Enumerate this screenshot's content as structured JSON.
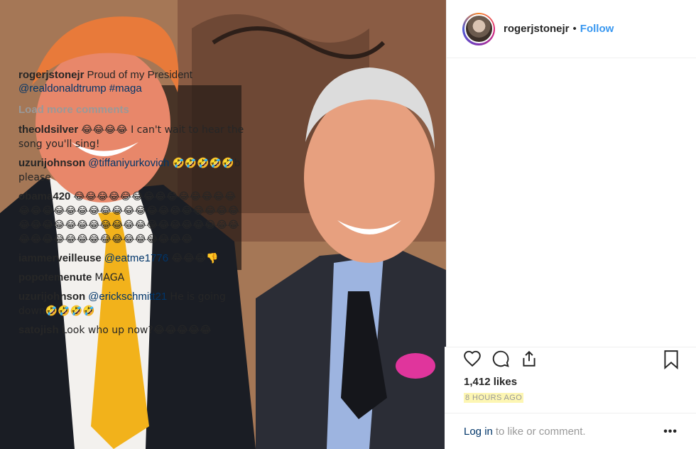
{
  "post": {
    "username": "rogerjstonejr",
    "separator": "•",
    "follow_label": "Follow"
  },
  "caption": {
    "user": "rogerjstonejr",
    "text": "Proud of my President",
    "mention": "@realdonaldtrump #maga"
  },
  "load_more_label": "Load more comments",
  "comments": [
    {
      "user": "theoldsilver",
      "mention": "",
      "text": "😂😂😂😂 I can't wait to hear the song you'll sing!"
    },
    {
      "user": "uzurijohnson",
      "mention": "@tiffaniyurkovich",
      "text": "🤣🤣🤣🤣🤣b please"
    },
    {
      "user": "obama420",
      "mention": "",
      "text": "😂😂😂😂😂😂😂😂😂😂😂😂😂😂😂😂😂😂😂😂😂😂😂😂😂😂😂😂😂😂😂😂😂😂😂😂😂😂😂😂😂😂😂😂😂😂😂😂😂😂😂😂😂😂😂😂😂😂😂😂😂😂😂😂😂😂😂"
    },
    {
      "user": "iammerveilleuse",
      "mention": "@eatme1776",
      "text": "😂😂😂👎"
    },
    {
      "user": "popotemenute",
      "mention": "",
      "text": "MAGA"
    },
    {
      "user": "uzurijohnson",
      "mention": "@erickschmitt21",
      "text": "He is going down🤣🤣🤣🤣"
    },
    {
      "user": "satojish",
      "mention": "",
      "text": "Look who up now?😂😂😂😂😂"
    }
  ],
  "likes": "1,412 likes",
  "time_ago": "8 HOURS AGO",
  "login": {
    "link": "Log in",
    "text": "to like or comment.",
    "more": "•••"
  },
  "icons": [
    "heart-icon",
    "comment-icon",
    "share-icon",
    "bookmark-icon"
  ],
  "colors": {
    "link": "#3897f0",
    "mention": "#003569",
    "muted": "#999999",
    "highlight": "#fdf6b3"
  }
}
